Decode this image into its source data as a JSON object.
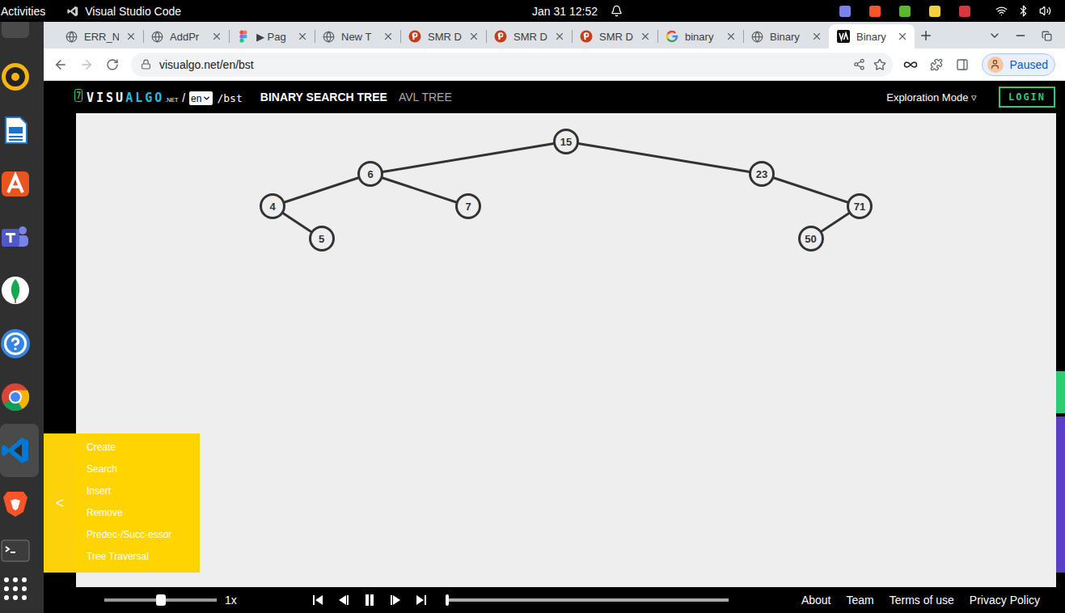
{
  "topbar": {
    "activities": "Activities",
    "app": "Visual Studio Code",
    "datetime": "Jan 31  12:52"
  },
  "tabs": [
    {
      "label": "ERR_N",
      "kind": "globe",
      "selected": false
    },
    {
      "label": "AddPr",
      "kind": "globe",
      "selected": false
    },
    {
      "label": "▶ Pag",
      "kind": "figma",
      "selected": false
    },
    {
      "label": "New T",
      "kind": "globe",
      "selected": false
    },
    {
      "label": "SMR D",
      "kind": "ppt",
      "selected": false
    },
    {
      "label": "SMR D",
      "kind": "ppt",
      "selected": false
    },
    {
      "label": "SMR D",
      "kind": "ppt",
      "selected": false
    },
    {
      "label": "binary",
      "kind": "google",
      "selected": false
    },
    {
      "label": "Binary",
      "kind": "globe",
      "selected": false
    },
    {
      "label": "Binary",
      "kind": "visualgo",
      "selected": true
    }
  ],
  "address": "visualgo.net/en/bst",
  "profile": "Paused",
  "site": {
    "logo": {
      "first": "VISU",
      "second": "ALGO",
      "suffix": ".NET"
    },
    "separator": "/",
    "lang": "en",
    "path": "/bst",
    "nav": [
      {
        "label": "BINARY SEARCH TREE",
        "selected": true
      },
      {
        "label": "AVL TREE",
        "selected": false
      }
    ],
    "mode": "Exploration Mode ▿",
    "login": "LOGIN"
  },
  "tree": {
    "value": "15",
    "left": {
      "value": "6",
      "left": {
        "value": "4",
        "left": null,
        "right": {
          "value": "5",
          "left": null,
          "right": null
        }
      },
      "right": {
        "value": "7",
        "left": null,
        "right": null
      }
    },
    "right": {
      "value": "23",
      "left": null,
      "right": {
        "value": "71",
        "left": {
          "value": "50",
          "left": null,
          "right": null
        },
        "right": null
      }
    }
  },
  "menu": {
    "toggle": "<",
    "items": [
      "Create",
      "Search",
      "Insert",
      "Remove",
      "Predec-/Succ-essor",
      "Tree Traversal"
    ]
  },
  "playback": {
    "speed": "1x",
    "speed_level": 0.5,
    "progress_level": 0.0
  },
  "footer": [
    "About",
    "Team",
    "Terms of use",
    "Privacy Policy"
  ]
}
